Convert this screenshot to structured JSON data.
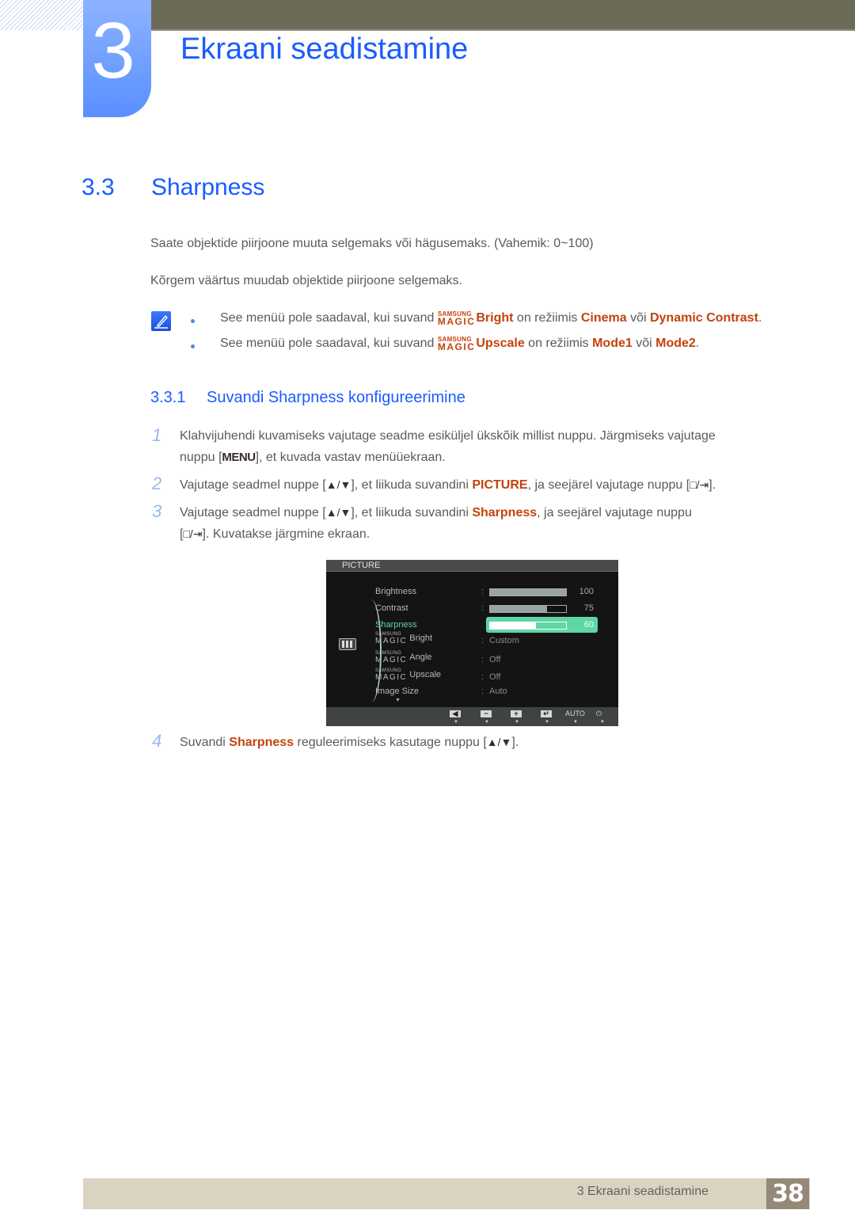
{
  "chapter": {
    "number": "3",
    "title": "Ekraani seadistamine"
  },
  "section": {
    "number": "3.3",
    "title": "Sharpness",
    "paragraphs": [
      "Saate objektide piirjoone muuta selgemaks või hägusemaks. (Vahemik: 0~100)",
      "Kõrgem väärtus muudab objektide piirjoone selgemaks."
    ],
    "notes": [
      {
        "prefix": "See menüü pole saadaval, kui suvand ",
        "magic_top": "SAMSUNG",
        "magic_bottom": "MAGIC",
        "option": "Bright",
        "middle": " on režiimis ",
        "mode1": "Cinema",
        "or": " või ",
        "mode2": "Dynamic Contrast",
        "end": "."
      },
      {
        "prefix": "See menüü pole saadaval, kui suvand ",
        "magic_top": "SAMSUNG",
        "magic_bottom": "MAGIC",
        "option": "Upscale",
        "middle": " on režiimis ",
        "mode1": "Mode1",
        "or": " või ",
        "mode2": "Mode2",
        "end": "."
      }
    ]
  },
  "subsection": {
    "number": "3.3.1",
    "title": "Suvandi Sharpness konfigureerimine",
    "steps": [
      {
        "num": "1",
        "line1": "Klahvijuhendi kuvamiseks vajutage seadme esiküljel ükskõik millist nuppu. Järgmiseks vajutage",
        "line2_pre": "nuppu [",
        "key": "MENU",
        "line2_post": "], et kuvada vastav menüüekraan."
      },
      {
        "num": "2",
        "pre": "Vajutage seadmel nuppe [",
        "keys": "▲/▼",
        "mid": "], et liikuda suvandini ",
        "hl": "PICTURE",
        "post": ", ja seejärel vajutage nuppu [",
        "keys2": "□/⇥",
        "end": "]."
      },
      {
        "num": "3",
        "pre": "Vajutage seadmel nuppe [",
        "keys": "▲/▼",
        "mid": "], et liikuda suvandini ",
        "hl": "Sharpness",
        "post": ", ja seejärel vajutage nuppu",
        "line2_pre": "[",
        "keys2": "□/⇥",
        "line2_post": "]. Kuvatakse järgmine ekraan."
      },
      {
        "num": "4",
        "pre": "Suvandi ",
        "hl": "Sharpness",
        "mid": " reguleerimiseks kasutage nuppu [",
        "keys": "▲/▼",
        "end": "]."
      }
    ]
  },
  "osd": {
    "header": "PICTURE",
    "items": [
      {
        "label": "Brightness",
        "type": "bar",
        "value": 100,
        "display": "100"
      },
      {
        "label": "Contrast",
        "type": "bar",
        "value": 75,
        "display": "75"
      },
      {
        "label": "Sharpness",
        "type": "bar",
        "value": 60,
        "display": "60",
        "selected": true
      },
      {
        "magic_top": "SAMSUNG",
        "magic_bottom": "MAGIC",
        "label": "Bright",
        "type": "text",
        "display": "Custom"
      },
      {
        "magic_top": "SAMSUNG",
        "magic_bottom": "MAGIC",
        "label": "Angle",
        "type": "text",
        "display": "Off"
      },
      {
        "magic_top": "SAMSUNG",
        "magic_bottom": "MAGIC",
        "label": "Upscale",
        "type": "text",
        "display": "Off"
      },
      {
        "label": "Image Size",
        "type": "text",
        "display": "Auto"
      }
    ],
    "more_indicator": "▼",
    "footer_buttons": [
      {
        "name": "left-button",
        "glyph": "◀"
      },
      {
        "name": "minus-button",
        "glyph": "−"
      },
      {
        "name": "plus-button",
        "glyph": "+"
      },
      {
        "name": "enter-button",
        "glyph": "↵"
      },
      {
        "name": "auto-button",
        "glyph": "AUTO"
      },
      {
        "name": "power-button",
        "glyph": "⏻"
      }
    ],
    "arrow": "▼"
  },
  "footer": {
    "chapter_label": "3 Ekraani seadistamine",
    "page_number": "38"
  },
  "colors": {
    "heading_blue": "#1a5cff",
    "highlight_orange": "#c4420c",
    "osd_selected": "#5ed6a6",
    "topbar": "#6b6b57",
    "footer_bg": "#d9d3c1",
    "page_box": "#968878"
  }
}
